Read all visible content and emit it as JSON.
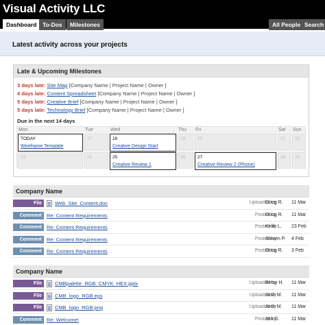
{
  "app_title": "Visual Activity LLC",
  "tabs": {
    "dashboard": "Dashboard",
    "todos": "To-Dos",
    "milestones": "Milestones",
    "all_people": "All People",
    "search": "Search"
  },
  "banner_title": "Latest activity across your projects",
  "milestones": {
    "heading": "Late & Upcoming Milestones",
    "late": [
      {
        "days": "3 days late:",
        "title": "Site Map",
        "meta": "[Company Name |  Project Name | Owner ]"
      },
      {
        "days": "4 days late:",
        "title": "Content Spreadsheet",
        "meta": "[Company Name |  Project Name | Owner ]"
      },
      {
        "days": "5 days late:",
        "title": "Creative Brief",
        "meta": "[Company Name |  Project Name | Owner ]"
      },
      {
        "days": "5 days late:",
        "title": "Technology Brief",
        "meta": "[Company Name |  Project Name | Owner ]"
      }
    ],
    "due_label": "Due in the next 14 days",
    "calendar": {
      "days": [
        "Mon",
        "Tue",
        "Wed",
        "Thu",
        "Fri",
        "Sat",
        "Sun"
      ],
      "week1": [
        {
          "num": "TODAY",
          "event": "Wireframe Template"
        },
        {
          "num": "17",
          "event": ""
        },
        {
          "num": "18",
          "event": "Creative Design Start"
        },
        {
          "num": "19",
          "event": ""
        },
        {
          "num": "20",
          "event": ""
        },
        {
          "num": "21",
          "event": ""
        },
        {
          "num": "22",
          "event": ""
        }
      ],
      "week2": [
        {
          "num": "23",
          "event": ""
        },
        {
          "num": "24",
          "event": ""
        },
        {
          "num": "25",
          "event": "Creative Review 1"
        },
        {
          "num": "26",
          "event": ""
        },
        {
          "num": "27",
          "event": "Creative Review 2 (Phone)"
        },
        {
          "num": "28",
          "event": ""
        },
        {
          "num": "29",
          "event": ""
        }
      ]
    }
  },
  "projects": [
    {
      "name": "Company Name",
      "rows": [
        {
          "type": "File",
          "icon": "document-icon",
          "title": "Web_Site_Content.doc",
          "verb": "Uploaded by",
          "person": "Doug R.",
          "date": "11 Mar"
        },
        {
          "type": "Comment",
          "icon": "",
          "title": "Re: Content Requirements",
          "verb": "Posted by",
          "person": "Doug R.",
          "date": "11 Mar"
        },
        {
          "type": "Comment",
          "icon": "",
          "title": "Re: Content Requirements",
          "verb": "Posted by",
          "person": "Keith L.",
          "date": "23 Feb"
        },
        {
          "type": "Comment",
          "icon": "",
          "title": "Re: Content Requirements",
          "verb": "Posted by",
          "person": "Steven P.",
          "date": "4 Feb"
        },
        {
          "type": "Comment",
          "icon": "",
          "title": "Re: Content Requirements",
          "verb": "Posted by",
          "person": "Doug R.",
          "date": "3 Feb"
        }
      ]
    },
    {
      "name": "Company Name",
      "rows": [
        {
          "type": "File",
          "icon": "document-icon",
          "title": "CMBpalette_RGB_CMYK_HEX.pptx",
          "verb": "Uploaded by",
          "person": "Betsy H.",
          "date": "11 Mar"
        },
        {
          "type": "File",
          "icon": "image-icon",
          "title": "CMB_logo_RGB.eps",
          "verb": "Uploaded by",
          "person": "Josh M.",
          "date": "11 Mar"
        },
        {
          "type": "File",
          "icon": "image-icon",
          "title": "CMB_logo_RGB.png",
          "verb": "Uploaded by",
          "person": "Josh M.",
          "date": "11 Mar"
        },
        {
          "type": "Comment",
          "icon": "",
          "title": "Re: Welcome!",
          "verb": "Posted by",
          "person": "Jon G.",
          "date": "11 Mar"
        }
      ]
    }
  ],
  "colors": {
    "header_bg": "#000000",
    "banner_bg": "#e5ecf5",
    "late_text": "#c0392b",
    "link": "#1a4fa0",
    "file_badge": "#7a5a95",
    "comment_badge": "#6f8fb0"
  }
}
